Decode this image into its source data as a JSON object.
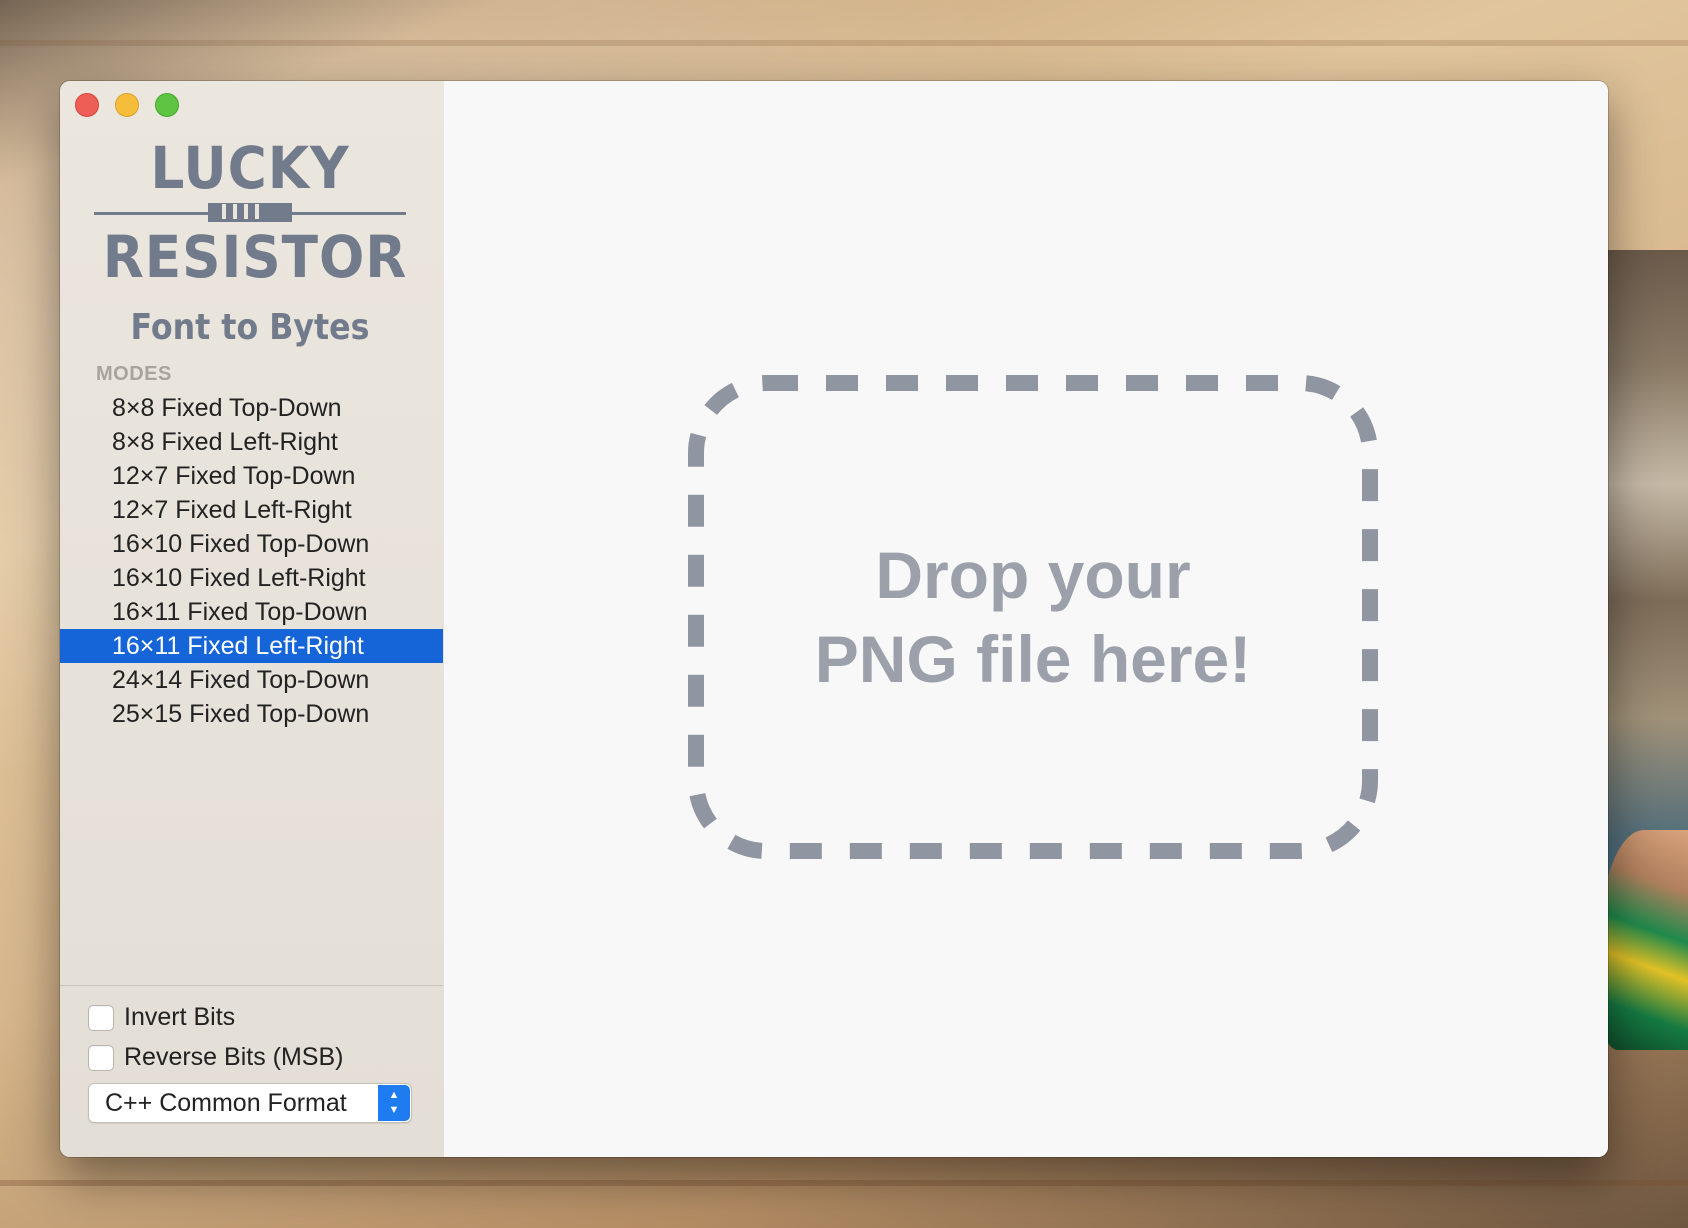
{
  "logo": {
    "line1": "LUCKY",
    "line2": "RESISTOR",
    "subtitle": "Font to Bytes"
  },
  "sidebar": {
    "modes_heading": "MODES",
    "modes": [
      {
        "label": "8×8 Fixed Top-Down",
        "selected": false
      },
      {
        "label": "8×8 Fixed Left-Right",
        "selected": false
      },
      {
        "label": "12×7 Fixed Top-Down",
        "selected": false
      },
      {
        "label": "12×7 Fixed Left-Right",
        "selected": false
      },
      {
        "label": "16×10 Fixed Top-Down",
        "selected": false
      },
      {
        "label": "16×10 Fixed Left-Right",
        "selected": false
      },
      {
        "label": "16×11 Fixed Top-Down",
        "selected": false
      },
      {
        "label": "16×11 Fixed Left-Right",
        "selected": true
      },
      {
        "label": "24×14 Fixed Top-Down",
        "selected": false
      },
      {
        "label": "25×15 Fixed Top-Down",
        "selected": false
      }
    ],
    "options": {
      "invert_bits": {
        "label": "Invert Bits",
        "checked": false
      },
      "reverse_bits": {
        "label": "Reverse Bits (MSB)",
        "checked": false
      }
    },
    "format_select": {
      "value": "C++ Common Format"
    }
  },
  "drop_zone": {
    "line1": "Drop your",
    "line2": "PNG file here!"
  },
  "colors": {
    "selection": "#1665d8",
    "logo": "#727b8c",
    "drop_border": "#8f95a1",
    "drop_text": "#9ba0aa",
    "select_accent": "#1f7bf0"
  },
  "icons": [
    "close-icon",
    "minimize-icon",
    "zoom-icon",
    "chevron-up-down-icon"
  ]
}
